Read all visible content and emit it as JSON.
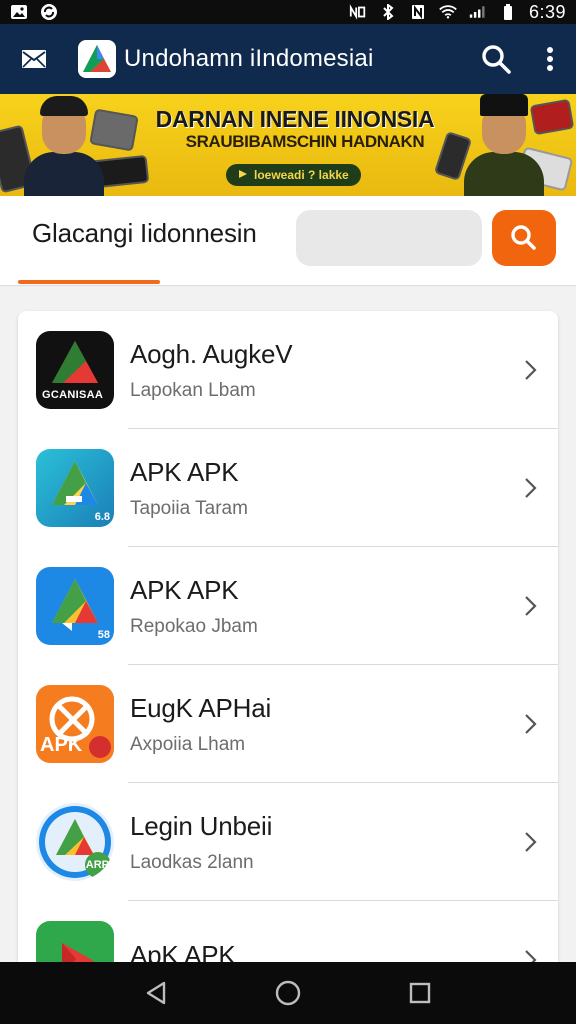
{
  "status_bar": {
    "time": "6:39",
    "left_icons": [
      "image-icon",
      "sync-icon"
    ],
    "right_icons": [
      "nfc-icon",
      "bluetooth-icon",
      "vibrate-icon",
      "wifi-icon",
      "signal-icon",
      "battery-icon"
    ]
  },
  "app_bar": {
    "title": "Undohamn iIndomesiai",
    "mail_icon": "mail-icon",
    "search_icon": "search-icon",
    "more_icon": "more-vert-icon"
  },
  "banner": {
    "title": "DARNAN INENE IINONSIA",
    "subtitle": "SRAUBIBAMSCHIN HADNAKN",
    "cta": "loeweadi ? lakke"
  },
  "tab": {
    "label": "Glacangi Iidonnesin",
    "search_placeholder": ""
  },
  "list": {
    "items": [
      {
        "name": "Aogh. AugkeV",
        "sub": "Lapokan Lbam",
        "icon_text": "GCANISAA",
        "icon_bg": "#111111"
      },
      {
        "name": "APK APK",
        "sub": "Tapoiia Taram",
        "icon_text": "6.8",
        "icon_bg": "#1fa8c8"
      },
      {
        "name": "APK APK",
        "sub": "Repokao Jbam",
        "icon_text": "58",
        "icon_bg": "#1e88e5"
      },
      {
        "name": "EugK APHai",
        "sub": "Axpoiia Lham",
        "icon_text": "APK",
        "icon_bg": "#f57c1f"
      },
      {
        "name": "Legin Unbeii",
        "sub": "Laodkas 2lann",
        "icon_text": "ARP",
        "icon_bg": "#e9f3fb"
      },
      {
        "name": "ApK APK",
        "sub": "",
        "icon_text": "",
        "icon_bg": "#2ea84a"
      }
    ]
  },
  "nav_bar": {
    "back_icon": "back-triangle-icon",
    "home_icon": "home-circle-icon",
    "recents_icon": "recents-square-icon"
  },
  "colors": {
    "app_bar": "#0f2a4d",
    "accent": "#f2650f",
    "banner": "#f7d21c"
  }
}
